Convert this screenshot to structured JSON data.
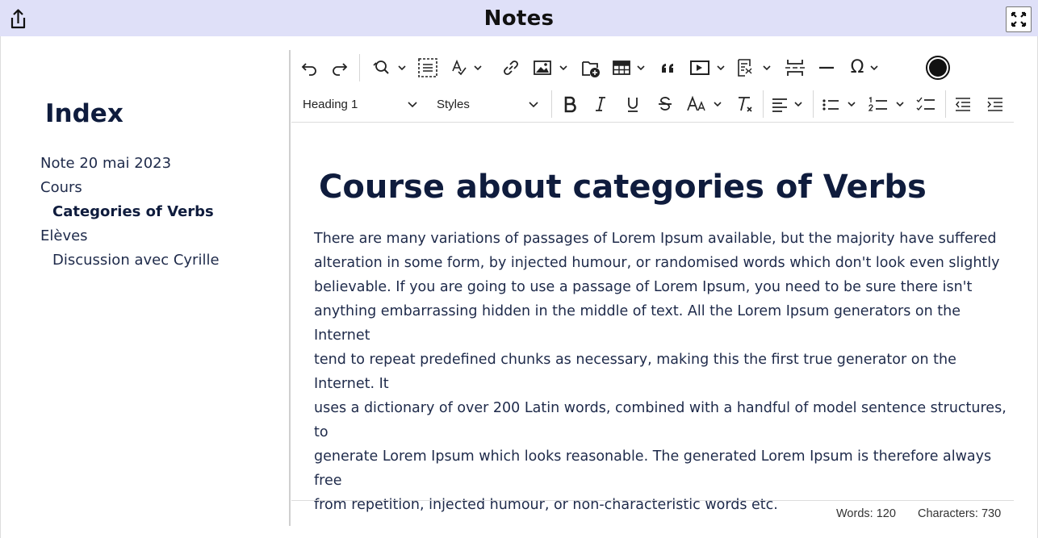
{
  "window": {
    "title": "Notes"
  },
  "sidebar": {
    "heading": "Index",
    "items": [
      {
        "label": "Note 20 mai 2023",
        "level": 0,
        "active": false
      },
      {
        "label": "Cours",
        "level": 0,
        "active": false
      },
      {
        "label": "Categories of Verbs",
        "level": 1,
        "active": true
      },
      {
        "label": "Elèves",
        "level": 0,
        "active": false
      },
      {
        "label": "Discussion avec Cyrille",
        "level": 1,
        "active": false
      }
    ]
  },
  "toolbar": {
    "block_format": "Heading 1",
    "styles": "Styles",
    "font_size_glyph": "AA",
    "special_char_glyph": "Ω",
    "icons": [
      "undo-icon",
      "redo-icon",
      "find-replace-icon",
      "select-all-icon",
      "spellcheck-icon",
      "link-icon",
      "image-icon",
      "insert-file-icon",
      "table-icon",
      "blockquote-icon",
      "media-icon",
      "template-icon",
      "page-break-icon",
      "horizontal-rule-icon",
      "special-char-icon",
      "record-icon",
      "bold-icon",
      "italic-icon",
      "underline-icon",
      "strikethrough-icon",
      "font-size-icon",
      "clear-format-icon",
      "align-icon",
      "bullet-list-icon",
      "numbered-list-icon",
      "checklist-icon",
      "outdent-icon",
      "indent-icon"
    ]
  },
  "document": {
    "heading": "Course about categories of Verbs",
    "lines": [
      "There are many variations of passages of Lorem Ipsum available, but the majority have suffered",
      "alteration in some form, by injected humour, or randomised words which don't look even slightly",
      "believable. If you are going to use a passage of Lorem Ipsum, you need to be sure there isn't",
      "anything embarrassing hidden in the middle of text. All the Lorem Ipsum generators on the Internet",
      "tend to repeat predefined chunks as necessary, making this the first true generator on the Internet. It",
      "uses a dictionary of over 200 Latin words, combined with a handful of model sentence structures, to",
      "generate Lorem Ipsum which looks reasonable. The generated Lorem Ipsum is therefore always free",
      "from repetition, injected humour, or non-characteristic words etc."
    ]
  },
  "status": {
    "words": "Words: 120",
    "characters": "Characters: 730"
  },
  "colors": {
    "titlebar_bg": "#dfe0f8",
    "heading": "#0f1c3d",
    "text": "#1e2a4a"
  }
}
